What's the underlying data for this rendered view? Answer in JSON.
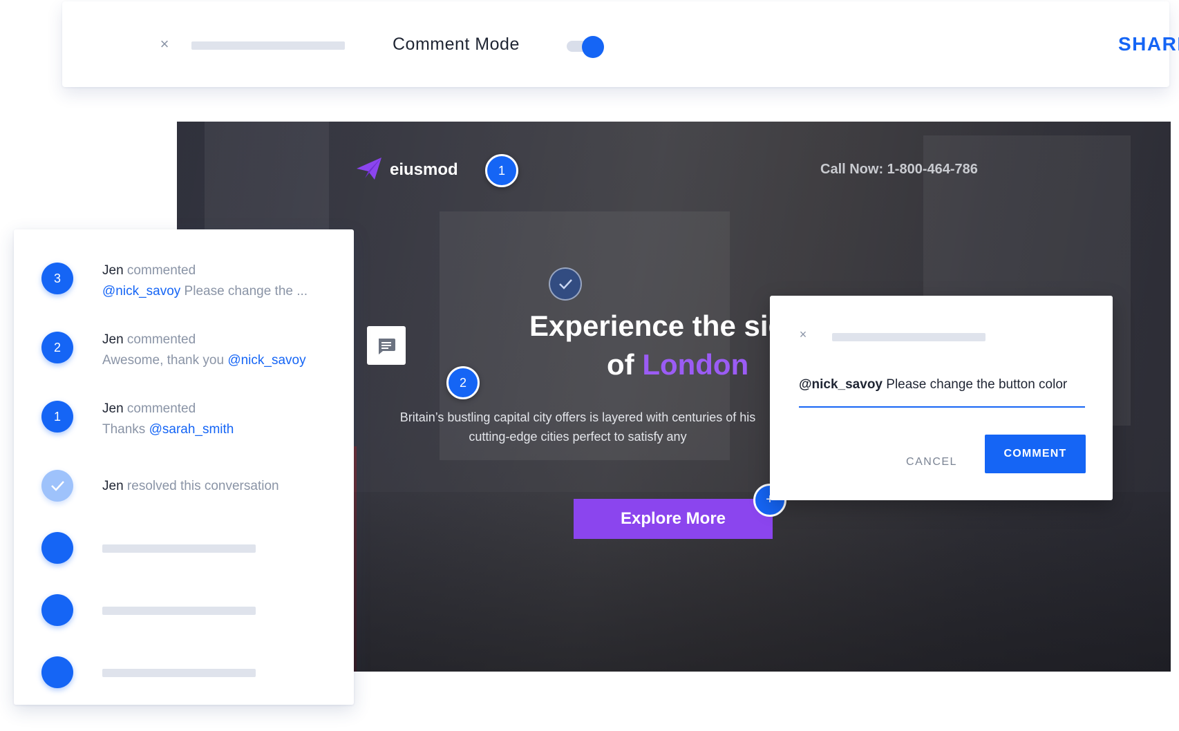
{
  "toolbar": {
    "title": "Comment Mode",
    "share_label": "SHARE",
    "toggle_on": true
  },
  "hero": {
    "brand": "eiusmod",
    "call_now": "Call Now: 1-800-464-786",
    "headline_line1": "Experience the sig",
    "headline_line2_prefix": "of ",
    "headline_line2_accent": "London",
    "subtext_line1": "Britain’s bustling capital city offers is layered with centuries of his",
    "subtext_line2": "cutting-edge cities perfect to satisfy any",
    "cta_label": "Explore More",
    "pins": [
      "1",
      "2"
    ],
    "add_pin_label": "+"
  },
  "popup": {
    "mention": "@nick_savoy",
    "text": " Please change the button color",
    "cancel_label": "CANCEL",
    "comment_label": "COMMENT"
  },
  "activity": [
    {
      "badge": "3",
      "user": "Jen",
      "action": " commented",
      "mention": "@nick_savoy",
      "text": " Please change the ...",
      "mention_first": true
    },
    {
      "badge": "2",
      "user": "Jen",
      "action": " commented",
      "text": "Awesome, thank you ",
      "mention": "@nick_savoy",
      "mention_first": false
    },
    {
      "badge": "1",
      "user": "Jen",
      "action": " commented",
      "text": "Thanks ",
      "mention": "@sarah_smith",
      "mention_first": false
    },
    {
      "user": "Jen",
      "action": " resolved this conversation"
    }
  ],
  "colors": {
    "accent": "#1565f5",
    "purple": "#8b45ee",
    "placeholder": "#dfe3ec"
  }
}
